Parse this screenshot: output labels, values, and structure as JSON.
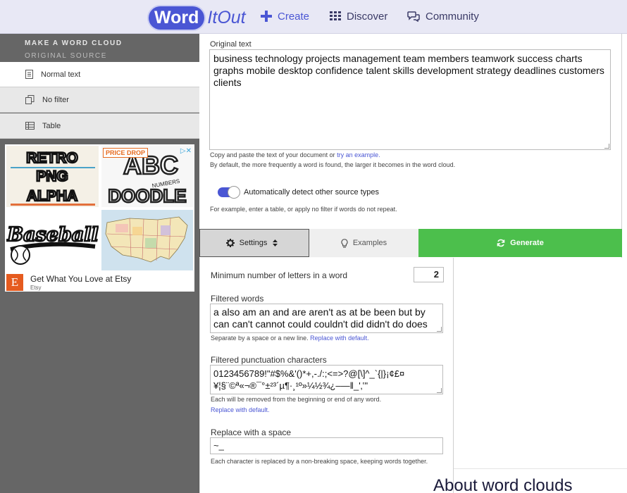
{
  "nav": {
    "logo_word": "Word",
    "logo_itout": "ItOut",
    "create": "Create",
    "discover": "Discover",
    "community": "Community"
  },
  "sidebar": {
    "title": "MAKE A WORD CLOUD",
    "subtitle": "ORIGINAL SOURCE",
    "options": [
      {
        "label": "Normal text"
      },
      {
        "label": "No filter"
      },
      {
        "label": "Table"
      }
    ]
  },
  "ad": {
    "tile1_text": "RETRO PNG ALPHA",
    "tile2_badge": "PRICE DROP",
    "tile2_text": "ABC NUMBERS DOODLE",
    "tile3_text": "Baseball",
    "close": "▷✕",
    "headline": "Get What You Love at Etsy",
    "brand": "Etsy",
    "brand_initial": "E"
  },
  "main": {
    "original_label": "Original text",
    "original_value": "business technology projects management team members teamwork success charts graphs mobile desktop confidence talent skills development strategy deadlines customers clients",
    "help1_prefix": "Copy and paste the text of your document or",
    "help1_link": "try an example.",
    "help2": "By default, the more frequently a word is found, the larger it becomes in the word cloud.",
    "toggle_label": "Automatically detect other source types",
    "help3": "For example, enter a table, or apply no filter if words do not repeat."
  },
  "tabs": {
    "settings": "Settings",
    "examples": "Examples",
    "generate": "Generate"
  },
  "settings": {
    "min_letters_label": "Minimum number of letters in a word",
    "min_letters_value": "2",
    "filtered_words_label": "Filtered words",
    "filtered_words_value": "a also am an and are aren't as at be been but by can can't cannot could couldn't did didn't do does",
    "sep_help": "Separate by a space or a new line.",
    "replace_default": "Replace with default.",
    "punct_label": "Filtered punctuation characters",
    "punct_line1": "0123456789!\"#$%&'()*+,-./:;<=>?@[\\]^_`{|}¡¢£¤",
    "punct_line2": "¥¦§¨©ª«¬®¯°±²³´µ¶·¸¹º»¼½¾¿–—‖_'‚‛\"",
    "punct_help": "Each will be removed from the beginning or end of any word.",
    "replace_default2": "Replace with default.",
    "space_label": "Replace with a space",
    "space_value": "~_",
    "space_help": "Each character is replaced by a non-breaking space, keeping words together."
  },
  "about": "About word clouds",
  "colors": {
    "brand": "#4a56d4",
    "generate": "#4cbf4c",
    "sidebar": "#666666"
  }
}
